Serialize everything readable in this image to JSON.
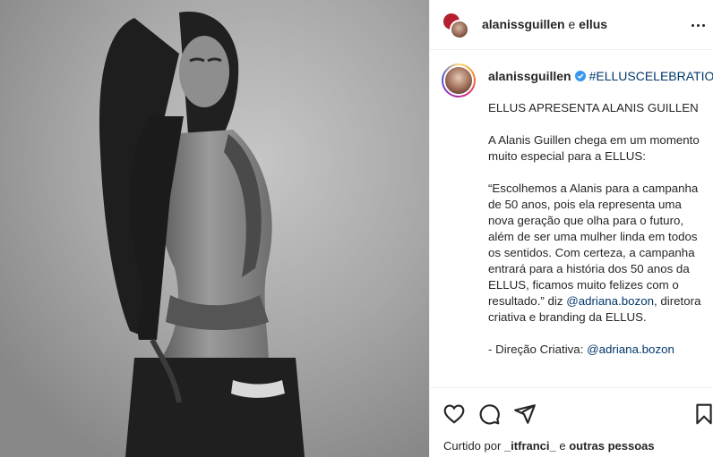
{
  "header": {
    "user": "alanissguillen",
    "connector": "e",
    "collaborator": "ellus"
  },
  "caption": {
    "user": "alanissguillen",
    "hashtag": "#ELLUSCELEBRATION",
    "paragraphs": [
      "ELLUS APRESENTA ALANIS GUILLEN",
      "A Alanis Guillen chega em um momento muito especial para a ELLUS:"
    ],
    "quote": "“Escolhemos a Alanis para a campanha de 50 anos, pois ela representa uma nova geração que olha para o futuro, além de ser uma mulher linda em todos os sentidos. Com certeza, a campanha entrará para a história dos 50 anos da ELLUS, ficamos muito felizes com o resultado.” diz",
    "quote_mention": "@adriana.bozon",
    "quote_tail": ", diretora criativa e branding da ELLUS.",
    "credit_label": "- Direção Criativa:",
    "credit_mention": "@adriana.bozon"
  },
  "likes": {
    "prefix": "Curtido por",
    "user": "_itfranci_",
    "connector": "e",
    "others": "outras pessoas"
  },
  "icons": {
    "like": "heart-icon",
    "comment": "comment-icon",
    "share": "share-icon",
    "save": "bookmark-icon",
    "more": "more-icon",
    "verified": "verified-icon"
  },
  "colors": {
    "link": "#00376b",
    "verified": "#3897f0",
    "text": "#262626"
  }
}
